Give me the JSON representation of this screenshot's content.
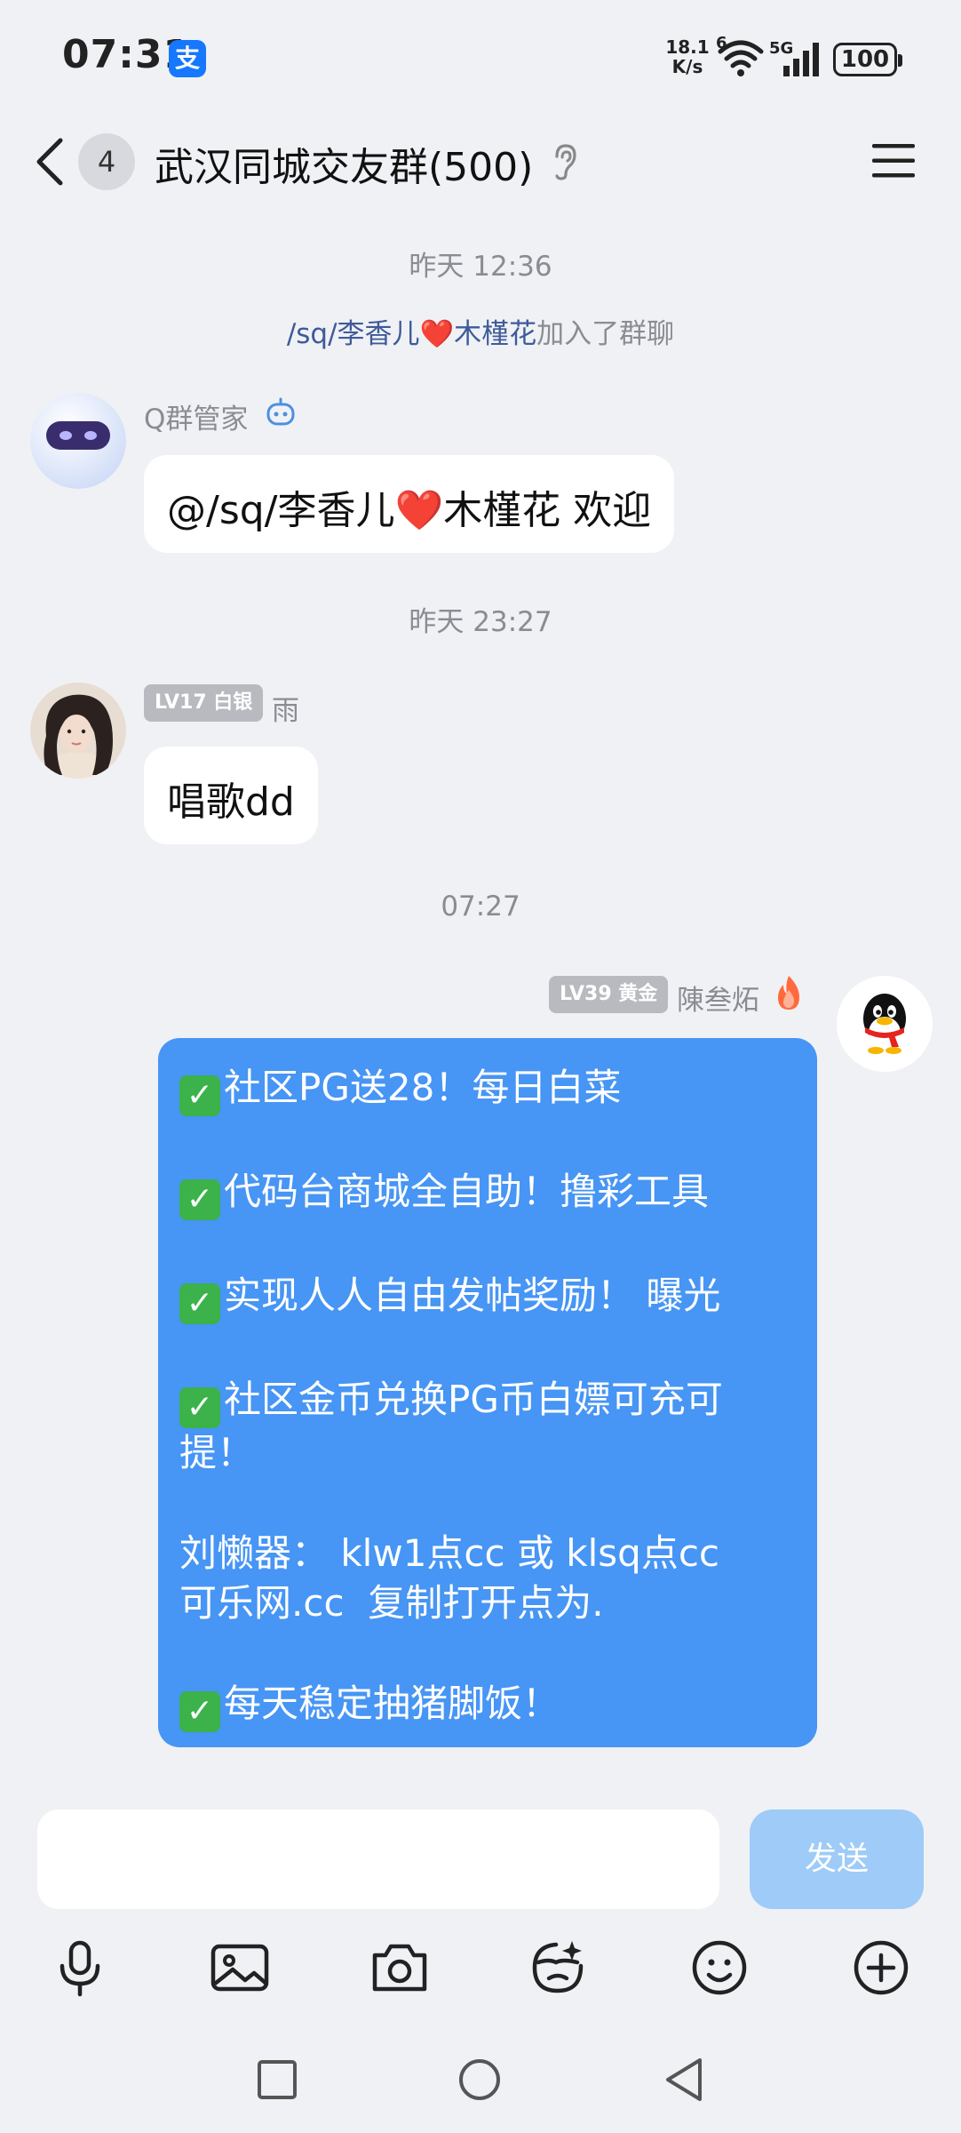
{
  "status_bar": {
    "time": "07:31",
    "alipay_glyph": "支",
    "net_speed_value": "18.1",
    "net_speed_unit": "K/s",
    "wifi_label": "6",
    "signal_label": "5G",
    "battery": "100"
  },
  "header": {
    "unread_count": "4",
    "title": "武汉同城交友群(500)"
  },
  "messages": {
    "ts1": "昨天 12:36",
    "system": {
      "name": "/sq/李香儿❤️木槿花",
      "text": "加入了群聊"
    },
    "bot": {
      "name": "Q群管家",
      "text": "@/sq/李香儿❤️木槿花 欢迎"
    },
    "ts2": "昨天 23:27",
    "user1": {
      "level": "LV17 白银",
      "name": "雨",
      "text": "唱歌dd"
    },
    "ts3": "07:27",
    "user2": {
      "level": "LV39 黄金",
      "name": "陳叁炻",
      "lines": [
        "社区PG送28！每日白菜",
        "代码台商城全自助！撸彩工具",
        "实现人人自由发帖奖励！ 曝光",
        "社区金币兑换PG币白嫖可充可",
        "提！",
        "刘懒器： klw1点cc 或 klsq点cc",
        "可乐网.cc  复制打开点为.",
        "每天稳定抽猪脚饭！"
      ]
    }
  },
  "input": {
    "placeholder": "",
    "send_label": "发送"
  },
  "toolbar": {
    "icons": [
      "microphone-icon",
      "image-icon",
      "camera-icon",
      "sticker-icon",
      "emoji-icon",
      "plus-icon"
    ]
  },
  "nav": {
    "icons": [
      "recents-icon",
      "home-icon",
      "back-nav-icon"
    ]
  },
  "colors": {
    "bubble_blue": "#4795f4",
    "send_disabled": "#9ecbf7",
    "link_name": "#3e5b99"
  }
}
